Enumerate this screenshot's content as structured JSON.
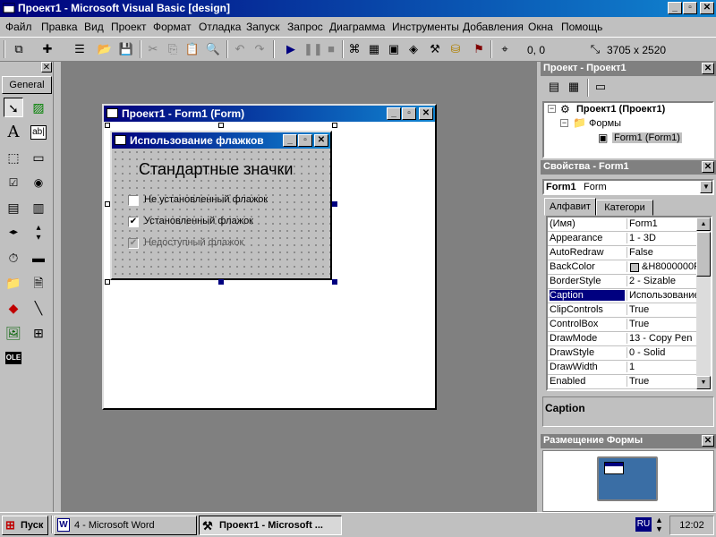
{
  "window": {
    "title": "Проект1 - Microsoft Visual Basic [design]"
  },
  "menu": [
    "Файл",
    "Правка",
    "Вид",
    "Проект",
    "Формат",
    "Отладка",
    "Запуск",
    "Запрос",
    "Диаграмма",
    "Инструменты",
    "Добавления",
    "Окна",
    "Помощь"
  ],
  "toolbar": {
    "position": "0, 0",
    "size": "3705 x 2520"
  },
  "toolbox": {
    "tab": "General",
    "label_tool": "A",
    "textbox_tool": "ab|",
    "ole_tool": "OLE"
  },
  "form_window": {
    "title": "Проект1 - Form1 (Form)"
  },
  "form": {
    "title": "Использование флажков",
    "heading": "Стандартные значки",
    "checkboxes": [
      {
        "label": "Не установленный флажок",
        "checked": false,
        "enabled": true
      },
      {
        "label": "Установленный флажок",
        "checked": true,
        "enabled": true
      },
      {
        "label": "Недоступный флажок",
        "checked": true,
        "enabled": false
      }
    ]
  },
  "project": {
    "title": "Проект - Проект1",
    "root": "Проект1 (Проект1)",
    "folder": "Формы",
    "item": "Form1 (Form1)"
  },
  "properties": {
    "title": "Свойства - Form1",
    "object_name": "Form1",
    "object_type": "Form",
    "tabs": [
      "Алфавит",
      "Категори"
    ],
    "rows": [
      {
        "name": "(Имя)",
        "value": "Form1"
      },
      {
        "name": "Appearance",
        "value": "1 - 3D"
      },
      {
        "name": "AutoRedraw",
        "value": "False"
      },
      {
        "name": "BackColor",
        "value": "&H8000000F"
      },
      {
        "name": "BorderStyle",
        "value": "2 - Sizable"
      },
      {
        "name": "Caption",
        "value": "Использование"
      },
      {
        "name": "ClipControls",
        "value": "True"
      },
      {
        "name": "ControlBox",
        "value": "True"
      },
      {
        "name": "DrawMode",
        "value": "13 - Copy Pen"
      },
      {
        "name": "DrawStyle",
        "value": "0 - Solid"
      },
      {
        "name": "DrawWidth",
        "value": "1"
      },
      {
        "name": "Enabled",
        "value": "True"
      }
    ],
    "selected": "Caption",
    "description": "Caption"
  },
  "layout_window": {
    "title": "Размещение Формы"
  },
  "taskbar": {
    "start": "Пуск",
    "tasks": [
      "4 - Microsoft Word",
      "Проект1 - Microsoft ..."
    ],
    "lang": "RU",
    "clock": "12:02"
  },
  "colors": {
    "titlebar": "#000080",
    "titlebar_end": "#1084d0",
    "face": "#c0c0c0",
    "mdi_bg": "#808080",
    "selection": "#000080"
  }
}
